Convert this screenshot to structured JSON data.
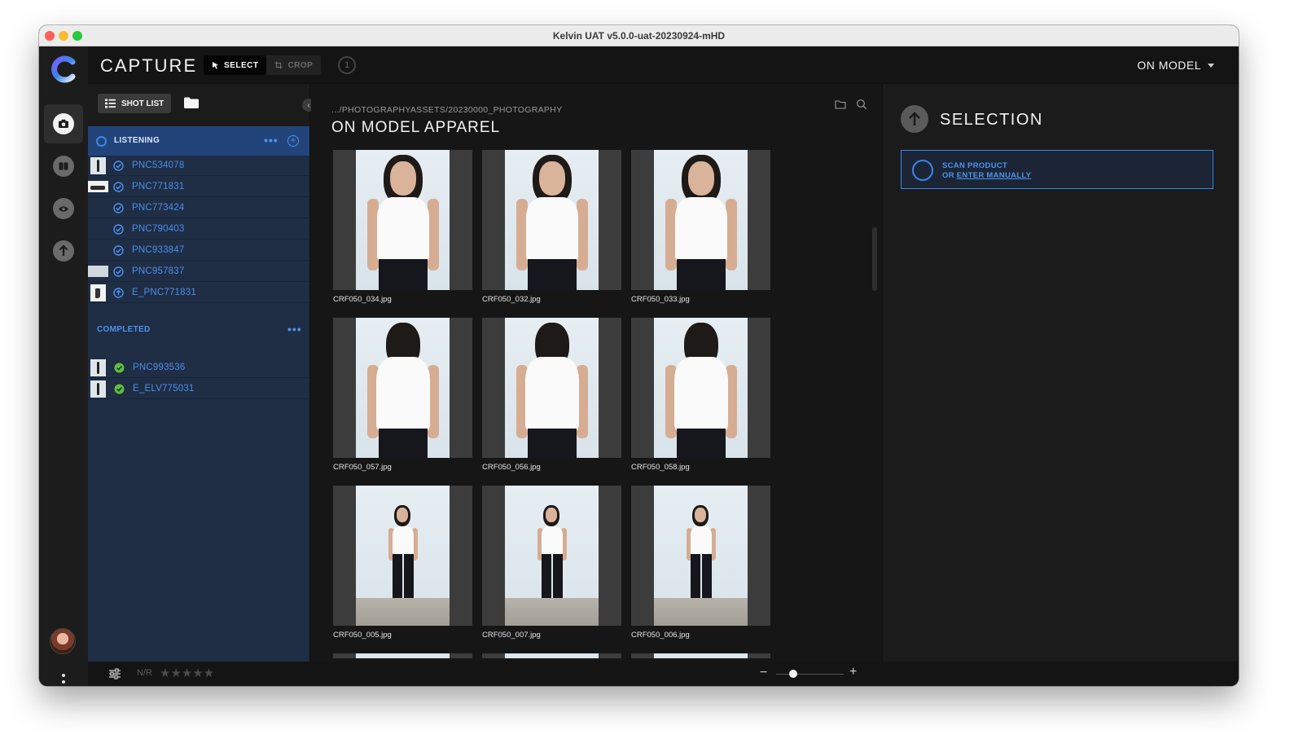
{
  "window": {
    "title": "Kelvin UAT v5.0.0-uat-20230924-mHD"
  },
  "header": {
    "app_name": "CAPTURE",
    "tools": [
      {
        "label": "SELECT",
        "icon": "cursor-icon",
        "selected": true
      },
      {
        "label": "CROP",
        "icon": "crop-icon",
        "selected": false
      }
    ],
    "selection_count": "1",
    "mode": "ON MODEL"
  },
  "left_panel": {
    "shot_list_label": "SHOT LIST",
    "listening": {
      "label": "LISTENING",
      "items": [
        {
          "label": "PNC534078",
          "thumb": "figure",
          "status": "check"
        },
        {
          "label": "PNC771831",
          "thumb": "shoe",
          "status": "check"
        },
        {
          "label": "PNC773424",
          "thumb": "none",
          "status": "check"
        },
        {
          "label": "PNC790403",
          "thumb": "none",
          "status": "check"
        },
        {
          "label": "PNC933847",
          "thumb": "none",
          "status": "check"
        },
        {
          "label": "PNC957837",
          "thumb": "wide",
          "status": "check"
        },
        {
          "label": "E_PNC771831",
          "thumb": "boot",
          "status": "upload"
        }
      ]
    },
    "completed": {
      "label": "COMPLETED",
      "items": [
        {
          "label": "PNC993536",
          "thumb": "figure",
          "status": "done"
        },
        {
          "label": "E_ELV775031",
          "thumb": "figure",
          "status": "done"
        }
      ]
    }
  },
  "center": {
    "path": ".../PHOTOGRAPHYASSETS/20230000_PHOTOGRAPHY",
    "title": "ON MODEL APPAREL",
    "images": [
      {
        "name": "CRF050_034.jpg",
        "pose": "front"
      },
      {
        "name": "CRF050_032.jpg",
        "pose": "front"
      },
      {
        "name": "CRF050_033.jpg",
        "pose": "front"
      },
      {
        "name": "CRF050_057.jpg",
        "pose": "back"
      },
      {
        "name": "CRF050_056.jpg",
        "pose": "back"
      },
      {
        "name": "CRF050_058.jpg",
        "pose": "back"
      },
      {
        "name": "CRF050_005.jpg",
        "pose": "full"
      },
      {
        "name": "CRF050_007.jpg",
        "pose": "full"
      },
      {
        "name": "CRF050_006.jpg",
        "pose": "full"
      }
    ]
  },
  "right_panel": {
    "title": "SELECTION",
    "scan_line1": "SCAN PRODUCT",
    "scan_or": "OR ",
    "scan_link": "ENTER MANUALLY"
  },
  "bottom": {
    "rating_label": "N/R",
    "stars": "★★★★★",
    "zoom_minus": "−",
    "zoom_plus": "+",
    "zoom_level": 0.25
  },
  "colors": {
    "accent": "#3b86e8",
    "panel_blue": "#1f2d45",
    "listening_bg": "#22447a",
    "done_green": "#5fbf3a"
  }
}
